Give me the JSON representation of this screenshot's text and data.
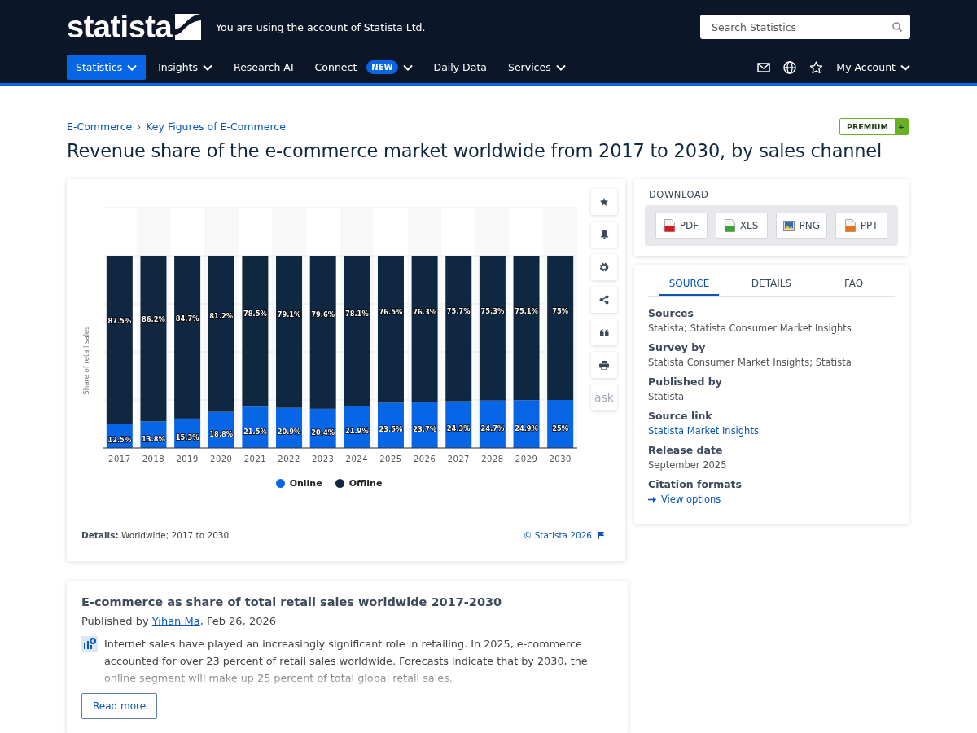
{
  "header": {
    "logo": "statista",
    "account_notice": "You are using the account of Statista Ltd.",
    "search": {
      "placeholder": "Search Statistics"
    },
    "nav": [
      {
        "label": "Statistics",
        "selected": true,
        "dropdown": true
      },
      {
        "label": "Insights",
        "selected": false,
        "dropdown": true
      },
      {
        "label": "Research AI",
        "selected": false,
        "dropdown": false
      },
      {
        "label": "Connect",
        "selected": false,
        "dropdown": true,
        "badge": "NEW"
      },
      {
        "label": "Daily Data",
        "selected": false,
        "dropdown": false
      },
      {
        "label": "Services",
        "selected": false,
        "dropdown": true
      }
    ],
    "utilities": [
      {
        "kind": "mail"
      },
      {
        "kind": "globe"
      },
      {
        "kind": "star"
      }
    ],
    "account": "My Account"
  },
  "breadcrumb": {
    "items": [
      "E-Commerce",
      "Key Figures of E-Commerce"
    ],
    "separator": "›"
  },
  "premium": {
    "label": "PREMIUM",
    "plus": "+"
  },
  "title": "Revenue share of the e-commerce market worldwide from 2017 to 2030, by sales channel",
  "chart_card": {
    "chart_data": {
      "type": "bar",
      "ylabel": "Share of retail sales",
      "stacked": true,
      "categories": [
        "2017",
        "2018",
        "2019",
        "2020",
        "2021",
        "2022",
        "2023",
        "2024",
        "2025",
        "2026",
        "2027",
        "2028",
        "2029",
        "2030"
      ],
      "series": [
        {
          "name": "Online",
          "color": "#0666e5",
          "values": [
            12.5,
            13.8,
            15.3,
            18.8,
            21.5,
            20.9,
            20.4,
            21.9,
            23.5,
            23.7,
            24.3,
            24.7,
            24.9,
            25
          ],
          "value_labels": [
            "12.5%",
            "13.8%",
            "15.3%",
            "18.8%",
            "21.5%",
            "20.9%",
            "20.4%",
            "21.9%",
            "23.5%",
            "23.7%",
            "24.3%",
            "24.7%",
            "24.9%",
            "25%"
          ]
        },
        {
          "name": "Offline",
          "color": "#0f2740",
          "values": [
            87.5,
            86.2,
            84.7,
            81.2,
            78.5,
            79.1,
            79.6,
            78.1,
            76.5,
            76.3,
            75.7,
            75.3,
            75.1,
            75
          ],
          "value_labels": [
            "87.5%",
            "86.2%",
            "84.7%",
            "81.2%",
            "78.5%",
            "79.1%",
            "79.6%",
            "78.1%",
            "76.5%",
            "76.3%",
            "75.7%",
            "75.3%",
            "75.1%",
            "75%"
          ]
        }
      ]
    },
    "tools": [
      {
        "kind": "star"
      },
      {
        "kind": "bell"
      },
      {
        "kind": "gear"
      },
      {
        "kind": "share"
      },
      {
        "kind": "quote"
      },
      {
        "kind": "print"
      },
      {
        "kind": "ask",
        "label": "ask"
      }
    ],
    "details_label": "Details:",
    "details_text": "Worldwide; 2017 to 2030",
    "copyright": "© Statista 2026"
  },
  "download": {
    "title": "DOWNLOAD",
    "buttons": [
      {
        "label": "PDF",
        "kind": "pdf"
      },
      {
        "label": "XLS",
        "kind": "xls"
      },
      {
        "label": "PNG",
        "kind": "png"
      },
      {
        "label": "PPT",
        "kind": "ppt"
      }
    ]
  },
  "source_panel": {
    "tabs": [
      {
        "label": "SOURCE",
        "selected": true
      },
      {
        "label": "DETAILS",
        "selected": false
      },
      {
        "label": "FAQ",
        "selected": false
      }
    ],
    "fields": [
      {
        "label": "Sources",
        "value": "Statista; Statista Consumer Market Insights",
        "kind": "text"
      },
      {
        "label": "Survey by",
        "value": "Statista Consumer Market Insights; Statista",
        "kind": "text"
      },
      {
        "label": "Published by",
        "value": "Statista",
        "kind": "text"
      },
      {
        "label": "Source link",
        "value": "Statista Market Insights",
        "kind": "link"
      },
      {
        "label": "Release date",
        "value": "September 2025",
        "kind": "text"
      },
      {
        "label": "Citation formats",
        "value": "View options",
        "kind": "action"
      }
    ]
  },
  "article": {
    "title": "E-commerce as share of total retail sales worldwide 2017-2030",
    "byline_prefix": "Published by",
    "author": "Yihan Ma",
    "byline_suffix": ", Feb 26, 2026",
    "body": "Internet sales have played an increasingly significant role in retailing. In 2025, e-commerce accounted for over 23 percent of retail sales worldwide. Forecasts indicate that by 2030, the online segment will make up 25 percent of total global retail sales.",
    "read_more": "Read more"
  }
}
